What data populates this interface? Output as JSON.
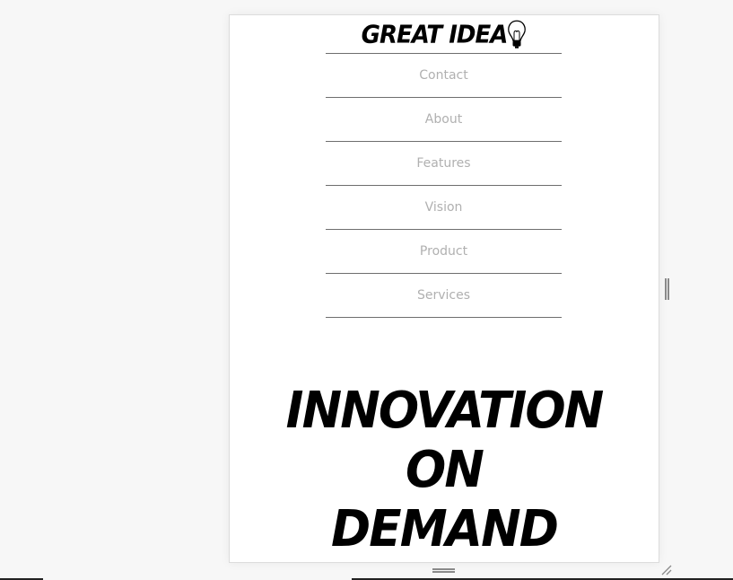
{
  "site": {
    "logo_text": "GREAT IDEA",
    "logo_icon": "lightbulb-icon"
  },
  "nav": {
    "items": [
      {
        "label": "Contact"
      },
      {
        "label": "About"
      },
      {
        "label": "Features"
      },
      {
        "label": "Vision"
      },
      {
        "label": "Product"
      },
      {
        "label": "Services"
      }
    ]
  },
  "hero": {
    "line1": "INNOVATION",
    "line2": "ON",
    "line3": "DEMAND"
  },
  "colors": {
    "nav_text": "#b0b0b0",
    "divider": "#6e6e6e",
    "headline": "#000000",
    "background": "#f7f7f7"
  }
}
